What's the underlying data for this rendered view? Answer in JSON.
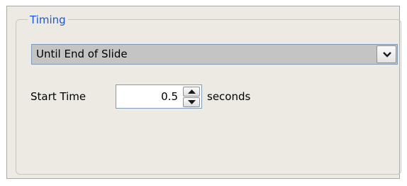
{
  "timing_group": {
    "title": "Timing",
    "mode_select": {
      "value": "Until End of Slide"
    },
    "start_time": {
      "label": "Start Time",
      "value": "0.5",
      "unit": "seconds"
    }
  },
  "icons": {
    "dropdown": "chevron-down-icon",
    "spin_up": "spin-up-arrow-icon",
    "spin_down": "spin-down-arrow-icon"
  },
  "colors": {
    "group_title": "#1c57d6",
    "panel_bg": "#eceae3",
    "select_bg": "#c4c4c4"
  }
}
